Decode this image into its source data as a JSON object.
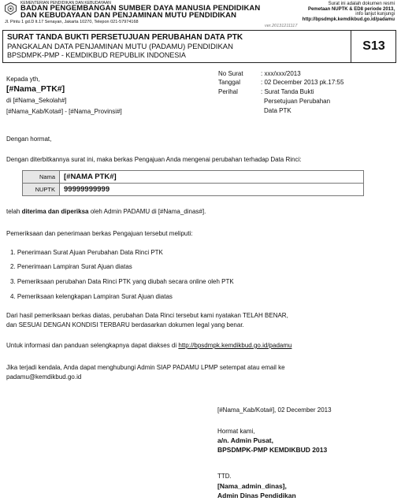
{
  "header": {
    "ministry": "KEMENTERIAN PENDIDIKAN DAN KEBUDAYAAN",
    "agency_line1": "BADAN PENGEMBANGAN SUMBER DAYA MANUSIA PENDIDIKAN",
    "agency_line2": "DAN KEBUDAYAAN DAN PENJAMINAN MUTU PENDIDIKAN",
    "address": "Jl. Pintu 1 gd.D lt.17 Senayan, Jakarta 10270, Telepon 021-57974168",
    "right_line1": "Surat ini adalah dokumen resmi",
    "right_line2": "Pemetaan NUPTK & ED8 periode 2013,",
    "right_line3": "info lanjut kunjungi",
    "right_line4": "http://bpsdmpk.kemdikbud.go.id/padamu"
  },
  "title_box": {
    "title": "SURAT TANDA BUKTI PERSETUJUAN PERUBAHAN DATA PTK",
    "subtitle1": "PANGKALAN DATA PENJAMINAN MUTU (PADAMU) PENDIDIKAN",
    "subtitle2": "BPSDMPK-PMP - KEMDIKBUD REPUBLIK INDONESIA",
    "version": "ver.20131211117",
    "code": "S13"
  },
  "recipient": {
    "salutation": "Kepada yth,",
    "name": "[#Nama_PTK#]",
    "school": "di [#Nama_Sekolah#]",
    "region": "[#Nama_Kab/Kota#] - [#Nama_Provinsi#]"
  },
  "meta": {
    "no_label": "No Surat",
    "no_value": ": xxx/xxx/2013",
    "date_label": "Tanggal",
    "date_value": ": 02 December 2013 pk.17:55",
    "subject_label": "Perihal",
    "subject_value1": ": Surat Tanda Bukti",
    "subject_value2": "Persetujuan Perubahan",
    "subject_value3": "Data PTK"
  },
  "body": {
    "greeting": "Dengan hormat,",
    "intro": "Dengan diterbitkannya surat ini, maka berkas Pengajuan Anda mengenai perubahan terhadap Data Rinci:",
    "table": [
      {
        "label": "Nama",
        "value": "[#NAMA PTK#]"
      },
      {
        "label": "NUPTK",
        "value": "99999999999"
      }
    ],
    "received_prefix": "telah ",
    "received_bold": "telah diterima dan diperiksa",
    "received_suffix": " oleh Admin PADAMU di [#Nama_dinas#].",
    "checks_intro": "Pemeriksaan dan penerimaan berkas Pengajuan tersebut meliputi:",
    "checks": [
      "1.  Penerimaan Surat Ajuan Perubahan Data Rinci PTK",
      "2.  Penerimaan Lampiran Surat Ajuan diatas",
      "3.  Pemeriksaan perubahan Data Rinci PTK yang diubah secara online oleh PTK",
      "4.  Pemeriksaan kelengkapan Lampiran Surat Ajuan diatas"
    ],
    "result_line1": "Dari hasil pemeriksaan berkas diatas, perubahan Data Rinci tersebut kami nyatakan TELAH BENAR,",
    "result_line2": "dan SESUAI DENGAN KONDISI TERBARU berdasarkan dokumen legal yang benar.",
    "info_prefix": "Untuk informasi dan panduan selengkapnya dapat diakses di ",
    "info_link": "http://bpsdmpk.kemdikbud.go.id/padamu",
    "contact_line1": "Jika terjadi kendala, Anda dapat menghubungi Admin SIAP PADAMU LPMP setempat atau email ke",
    "contact_line2": "padamu@kemdikbud.go.id"
  },
  "signature": {
    "place_date": "[#Nama_Kab/Kota#], 02 December 2013",
    "regards": "Hormat kami,",
    "on_behalf": "a/n. Admin Pusat,",
    "org": "BPSDMPK-PMP KEMDIKBUD 2013",
    "ttd": "TTD.",
    "admin_name": "[Nama_admin_dinas],",
    "admin_title": "Admin Dinas Pendidikan"
  }
}
